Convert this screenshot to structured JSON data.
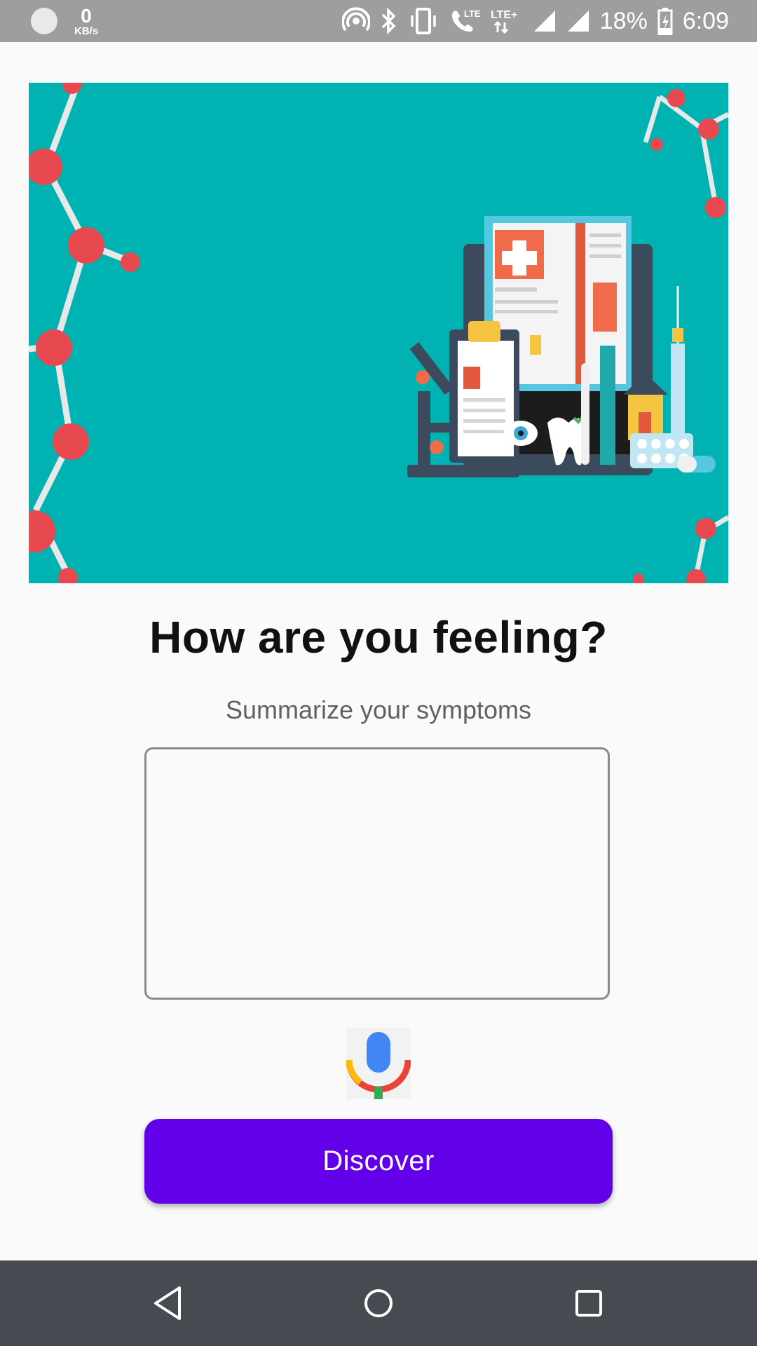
{
  "status_bar": {
    "net_speed_value": "0",
    "net_speed_unit": "KB/s",
    "icons": [
      "hotspot-icon",
      "bluetooth-icon",
      "vibrate-icon",
      "lte-call-icon",
      "lte-plus-icon",
      "signal-icon",
      "signal-icon",
      "battery-charging-icon"
    ],
    "battery": "18%",
    "time": "6:09"
  },
  "main": {
    "title": "How are you feeling?",
    "subtitle": "Summarize your symptoms",
    "symptom_input": {
      "value": "",
      "placeholder": ""
    },
    "mic_icon": "microphone-icon",
    "discover_label": "Discover"
  },
  "nav_bar": {
    "icons": [
      "back-icon",
      "home-icon",
      "recents-icon"
    ]
  },
  "colors": {
    "status_bar": "#9e9e9e",
    "banner_bg": "#00b3b2",
    "button": "#6200ea",
    "nav_bar": "#454b51"
  }
}
